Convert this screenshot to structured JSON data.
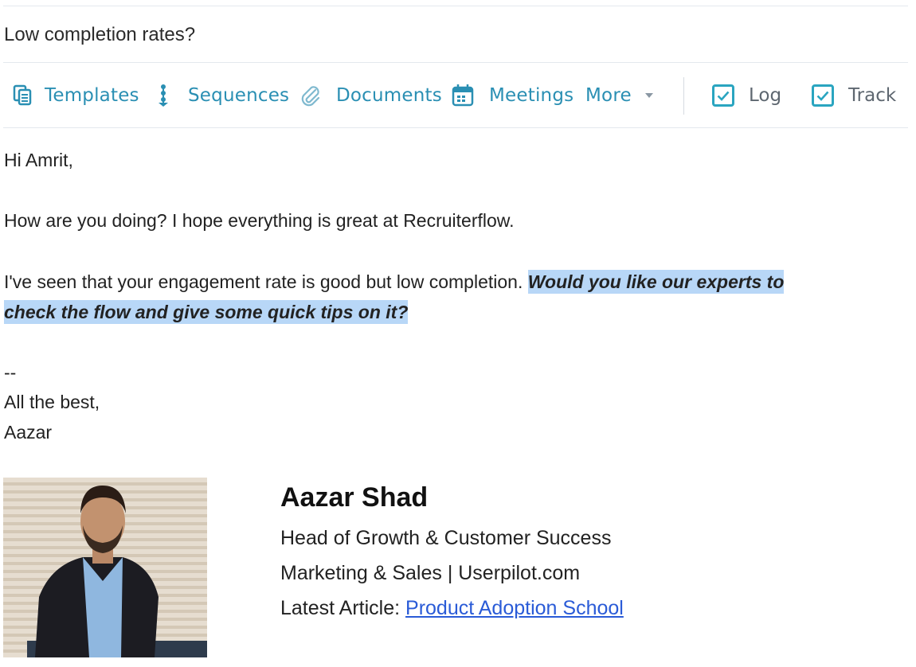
{
  "subject": "Low completion rates?",
  "toolbar": {
    "templates": "Templates",
    "sequences": "Sequences",
    "documents": "Documents",
    "meetings": "Meetings",
    "more": "More",
    "log": "Log",
    "track": "Track"
  },
  "body": {
    "greeting": "Hi Amrit,",
    "line1": "How are you doing? I hope everything is great at Recruiterflow.",
    "line2_plain": "I've seen that your engagement rate is good but low completion. ",
    "line2_highlight_a": "Would you like our experts to ",
    "line2_highlight_b": "check the flow and give some quick tips on it?",
    "dashes": "--",
    "closing": "All the best,",
    "sender": "Aazar"
  },
  "signature": {
    "name": "Aazar Shad",
    "title": "Head of Growth & Customer Success",
    "dept": "Marketing & Sales | Userpilot.com",
    "article_label": "Latest Article: ",
    "article_link": "Product Adoption School"
  },
  "colors": {
    "accent": "#2a8fb3",
    "checkbox": "#2aa5c0",
    "highlight": "#b8d7f7",
    "link": "#2a5bd7"
  }
}
